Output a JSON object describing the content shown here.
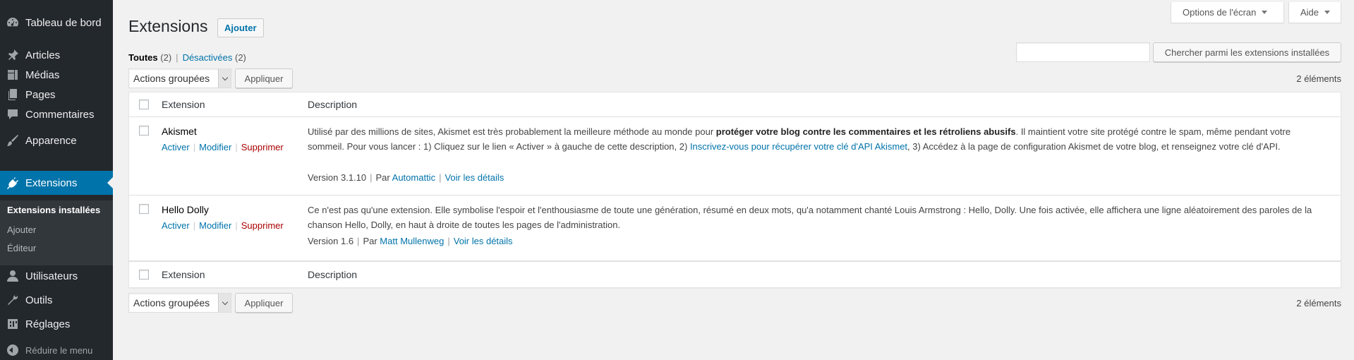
{
  "menu": {
    "items": [
      {
        "label": "Tableau de bord",
        "icon": "dashboard-icon"
      },
      {
        "label": "Articles",
        "icon": "pin-icon"
      },
      {
        "label": "Médias",
        "icon": "media-icon"
      },
      {
        "label": "Pages",
        "icon": "pages-icon"
      },
      {
        "label": "Commentaires",
        "icon": "comment-icon"
      },
      {
        "label": "Apparence",
        "icon": "brush-icon"
      },
      {
        "label": "Extensions",
        "icon": "plugin-icon"
      },
      {
        "label": "Utilisateurs",
        "icon": "user-icon"
      },
      {
        "label": "Outils",
        "icon": "wrench-icon"
      },
      {
        "label": "Réglages",
        "icon": "settings-icon"
      }
    ],
    "submenu": [
      "Extensions installées",
      "Ajouter",
      "Éditeur"
    ],
    "collapse_label": "Réduire le menu"
  },
  "screen_meta": {
    "options_label": "Options de l'écran",
    "help_label": "Aide"
  },
  "page": {
    "title": "Extensions",
    "add_new_label": "Ajouter"
  },
  "filters": {
    "all_label": "Toutes",
    "all_count": "(2)",
    "separator": "|",
    "inactive_label": "Désactivées",
    "inactive_count": "(2)"
  },
  "search": {
    "placeholder": "",
    "button_label": "Chercher parmi les extensions installées"
  },
  "tablenav": {
    "bulk_label": "Actions groupées",
    "apply_label": "Appliquer",
    "count": "2 éléments"
  },
  "table": {
    "col_name": "Extension",
    "col_description": "Description",
    "plugins": [
      {
        "name": "Akismet",
        "actions": [
          "Activer",
          "Modifier",
          "Supprimer"
        ],
        "desc_1": "Utilisé par des millions de sites, Akismet est très probablement la meilleure méthode au monde pour ",
        "desc_bold": "protéger votre blog contre les commentaires et les rétroliens abusifs",
        "desc_2": ". Il maintient votre site protégé contre le spam, même pendant votre sommeil. Pour vous lancer : 1) Cliquez sur le lien « Activer » à gauche de cette description, 2) ",
        "desc_link": "Inscrivez-vous pour récupérer votre clé d'API Akismet",
        "desc_3": ", 3) Accédez à la page de configuration Akismet de votre blog, et renseignez votre clé d'API.",
        "version": "Version 3.1.10",
        "by": "Par",
        "author": "Automattic",
        "details": "Voir les détails"
      },
      {
        "name": "Hello Dolly",
        "actions": [
          "Activer",
          "Modifier",
          "Supprimer"
        ],
        "desc": "Ce n'est pas qu'une extension. Elle symbolise l'espoir et l'enthousiasme de toute une génération, résumé en deux mots, qu'a notamment chanté Louis Armstrong : Hello, Dolly. Une fois activée, elle affichera une ligne aléatoirement des paroles de la chanson Hello, Dolly, en haut à droite de toutes les pages de l'administration.",
        "version": "Version 1.6",
        "by": "Par",
        "author": "Matt Mullenweg",
        "details": "Voir les détails"
      }
    ]
  },
  "colors": {
    "menu_bg": "#23282d",
    "accent": "#0073aa",
    "delete": "#aa0000",
    "page_bg": "#f1f1f1"
  }
}
